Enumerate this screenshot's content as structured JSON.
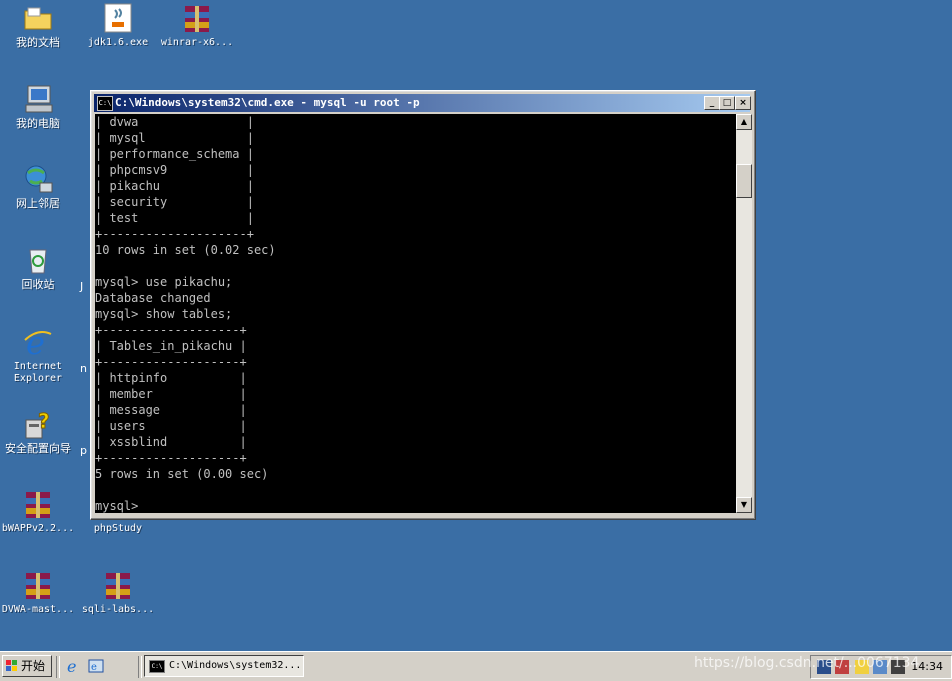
{
  "desktop": {
    "icons": [
      {
        "label": "我的文档"
      },
      {
        "label": "jdk1.6.exe"
      },
      {
        "label": "winrar-x6..."
      },
      {
        "label": "我的电脑"
      },
      {
        "label": "网上邻居"
      },
      {
        "label": "回收站"
      },
      {
        "label": "Internet Explorer"
      },
      {
        "label": "安全配置向导"
      },
      {
        "label": "bWAPPv2.2..."
      },
      {
        "label": "phpStudy"
      },
      {
        "label": "DVWA-mast..."
      },
      {
        "label": "sqli-labs..."
      }
    ],
    "partial_labels": {
      "j": "J",
      "n": "n",
      "p": "p"
    }
  },
  "window": {
    "title": "C:\\Windows\\system32\\cmd.exe - mysql -u root -p",
    "icon_text": "C:\\",
    "controls": {
      "minimize": "_",
      "maximize": "□",
      "close": "×"
    },
    "console_lines": [
      "| dvwa               |",
      "| mysql              |",
      "| performance_schema |",
      "| phpcmsv9           |",
      "| pikachu            |",
      "| security           |",
      "| test               |",
      "+--------------------+",
      "10 rows in set (0.02 sec)",
      "",
      "mysql> use pikachu;",
      "Database changed",
      "mysql> show tables;",
      "+-------------------+",
      "| Tables_in_pikachu |",
      "+-------------------+",
      "| httpinfo          |",
      "| member            |",
      "| message           |",
      "| users             |",
      "| xssblind          |",
      "+-------------------+",
      "5 rows in set (0.00 sec)",
      "",
      "mysql>"
    ],
    "scroll": {
      "up": "▲",
      "down": "▼"
    }
  },
  "taskbar": {
    "start_label": "开始",
    "task_button_label": "C:\\Windows\\system32...",
    "clock": "14:34",
    "watermark": "https://blog.csdn.net/...0067134"
  },
  "colors": {
    "desktop": "#3a6ea5",
    "titlebar_start": "#0a246a",
    "titlebar_end": "#a6caf0",
    "console_bg": "#000000",
    "console_text": "#c0c0c0"
  }
}
